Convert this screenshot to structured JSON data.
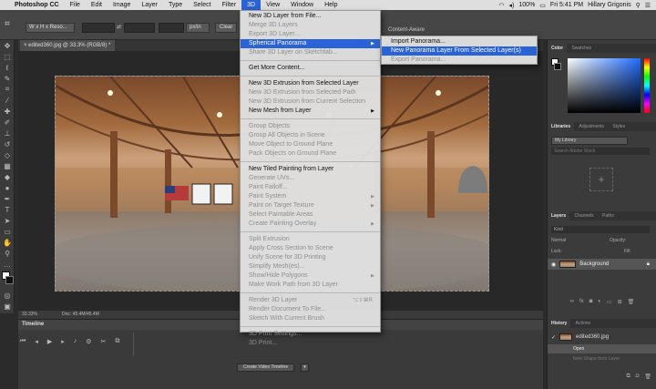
{
  "menubar": {
    "app_name": "Photoshop CC",
    "items": [
      "File",
      "Edit",
      "Image",
      "Layer",
      "Type",
      "Select",
      "Filter",
      "3D",
      "View",
      "Window",
      "Help"
    ],
    "active_item": "3D",
    "battery": "100%",
    "clock": "Fri 5:41 PM",
    "user": "Hillary Grigonis"
  },
  "options_bar": {
    "style_select": "W x H x Reso...",
    "unit": "px/in",
    "clear_label": "Clear",
    "content_aware": "Content-Aware"
  },
  "document": {
    "tab_title": "edited360.jpg @ 33.3% (RGB/8) *",
    "zoom": "33.33%",
    "doc_size": "Doc: 45.4M/45.4M"
  },
  "menu_3d": {
    "groups": [
      [
        {
          "label": "New 3D Layer from File...",
          "enabled": true
        },
        {
          "label": "Merge 3D Layers",
          "enabled": false
        },
        {
          "label": "Export 3D Layer...",
          "enabled": false
        },
        {
          "label": "Spherical Panorama",
          "enabled": true,
          "submenu": true,
          "highlighted": true
        },
        {
          "label": "Share 3D Layer on Sketchfab...",
          "enabled": false
        }
      ],
      [
        {
          "label": "Get More Content...",
          "enabled": true
        }
      ],
      [
        {
          "label": "New 3D Extrusion from Selected Layer",
          "enabled": true
        },
        {
          "label": "New 3D Extrusion from Selected Path",
          "enabled": false
        },
        {
          "label": "New 3D Extrusion from Current Selection",
          "enabled": false
        },
        {
          "label": "New Mesh from Layer",
          "enabled": true,
          "submenu": true
        }
      ],
      [
        {
          "label": "Group Objects",
          "enabled": false
        },
        {
          "label": "Group All Objects in Scene",
          "enabled": false
        },
        {
          "label": "Move Object to Ground Plane",
          "enabled": false
        },
        {
          "label": "Pack Objects on Ground Plane",
          "enabled": false
        }
      ],
      [
        {
          "label": "New Tiled Painting from Layer",
          "enabled": true
        },
        {
          "label": "Generate UVs...",
          "enabled": false
        },
        {
          "label": "Paint Falloff...",
          "enabled": false
        },
        {
          "label": "Paint System",
          "enabled": false,
          "submenu": true
        },
        {
          "label": "Paint on Target Texture",
          "enabled": false,
          "submenu": true
        },
        {
          "label": "Select Paintable Areas",
          "enabled": false
        },
        {
          "label": "Create Painting Overlay",
          "enabled": false,
          "submenu": true
        }
      ],
      [
        {
          "label": "Split Extrusion",
          "enabled": false
        },
        {
          "label": "Apply Cross Section to Scene",
          "enabled": false
        },
        {
          "label": "Unify Scene for 3D Printing",
          "enabled": false
        },
        {
          "label": "Simplify Mesh(es)...",
          "enabled": false
        },
        {
          "label": "Show/Hide Polygons",
          "enabled": false,
          "submenu": true
        },
        {
          "label": "Make Work Path from 3D Layer",
          "enabled": false
        }
      ],
      [
        {
          "label": "Render 3D Layer",
          "enabled": false,
          "shortcut": "⌥⇧⌘R"
        },
        {
          "label": "Render Document To File...",
          "enabled": false
        },
        {
          "label": "Sketch With Current Brush",
          "enabled": false
        }
      ],
      [
        {
          "label": "3D Print Settings...",
          "enabled": false
        },
        {
          "label": "3D Print...",
          "enabled": false
        }
      ]
    ]
  },
  "submenu_panorama": [
    {
      "label": "Import Panorama...",
      "enabled": true
    },
    {
      "label": "New Panorama Layer From Selected Layer(s)",
      "enabled": true,
      "highlighted": true
    },
    {
      "label": "Export Panorama...",
      "enabled": false
    }
  ],
  "panels": {
    "color": {
      "tabs": [
        "Color",
        "Swatches"
      ]
    },
    "libraries": {
      "tabs": [
        "Libraries",
        "Adjustments",
        "Styles"
      ],
      "library": "My Library",
      "search_placeholder": "Search Adobe Stock"
    },
    "layers": {
      "tabs": [
        "Layers",
        "Channels",
        "Paths"
      ],
      "kind": "Kind",
      "blend": "Normal",
      "opacity_label": "Opacity:",
      "lock_label": "Lock:",
      "fill_label": "Fill:",
      "layer_name": "Background"
    },
    "history": {
      "tabs": [
        "History",
        "Actions"
      ],
      "snapshot": "edited360.jpg",
      "states": [
        "Open",
        "New Shape from Layer"
      ]
    }
  },
  "timeline": {
    "title": "Timeline",
    "create_button": "Create Video Timeline"
  }
}
